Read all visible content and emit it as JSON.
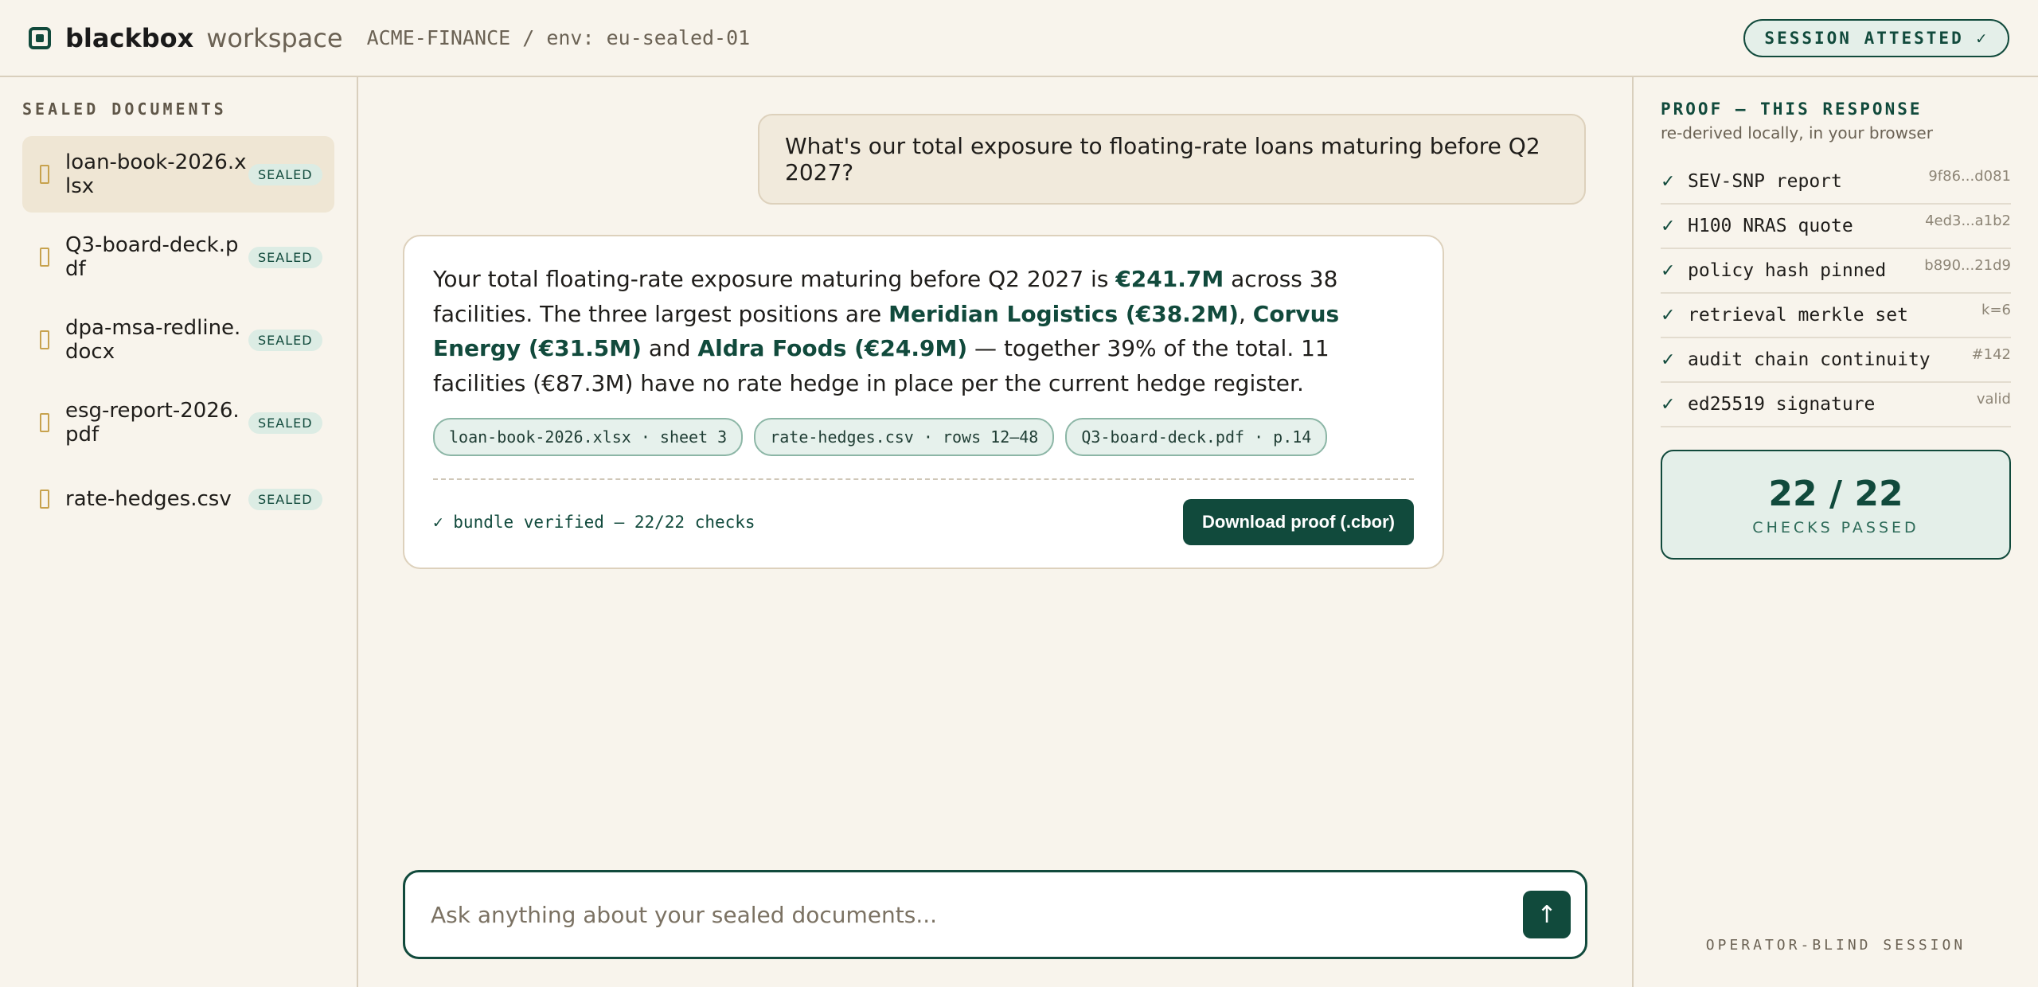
{
  "header": {
    "brand": "blackbox",
    "brand_sub": "workspace",
    "crumb": "ACME-FINANCE / env: eu-sealed-01",
    "session_badge": "SESSION ATTESTED ✓"
  },
  "sidebar": {
    "title": "SEALED DOCUMENTS",
    "items": [
      {
        "name": "loan-book-2026.xlsx",
        "badge": "SEALED"
      },
      {
        "name": "Q3-board-deck.pdf",
        "badge": "SEALED"
      },
      {
        "name": "dpa-msa-redline.docx",
        "badge": "SEALED"
      },
      {
        "name": "esg-report-2026.pdf",
        "badge": "SEALED"
      },
      {
        "name": "rate-hedges.csv",
        "badge": "SEALED"
      }
    ]
  },
  "chat": {
    "user_message": "What's our total exposure to floating-rate loans maturing before Q2 2027?",
    "answer": {
      "p1": "Your total floating-rate exposure maturing before Q2 2027 is ",
      "h1": "€241.7M",
      "p2": " across 38 facilities. The three largest positions are ",
      "h2": "Meridian Logistics (€38.2M)",
      "p3": ", ",
      "h3": "Corvus Energy (€31.5M)",
      "p4": " and ",
      "h4": "Aldra Foods (€24.9M)",
      "p5": " — together 39% of the total. 11 facilities (€87.3M) have no rate hedge in place per the current hedge register."
    },
    "sources": [
      "loan-book-2026.xlsx · sheet 3",
      "rate-hedges.csv · rows 12–48",
      "Q3-board-deck.pdf · p.14"
    ],
    "verified": "✓ bundle verified — 22/22 checks",
    "download_label": "Download proof (.cbor)"
  },
  "composer": {
    "placeholder": "Ask anything about your sealed documents...",
    "send_icon": "↑"
  },
  "proof": {
    "title": "PROOF — THIS RESPONSE",
    "subtitle": "re-derived locally, in your browser",
    "checks": [
      {
        "label": "SEV-SNP report",
        "value": "9f86...d081"
      },
      {
        "label": "H100 NRAS quote",
        "value": "4ed3...a1b2"
      },
      {
        "label": "policy hash pinned",
        "value": "b890...21d9"
      },
      {
        "label": "retrieval merkle set",
        "value": "k=6"
      },
      {
        "label": "audit chain continuity",
        "value": "#142"
      },
      {
        "label": "ed25519 signature",
        "value": "valid"
      }
    ],
    "score": "22 / 22",
    "score_label": "CHECKS PASSED",
    "footer": "OPERATOR-BLIND SESSION"
  }
}
